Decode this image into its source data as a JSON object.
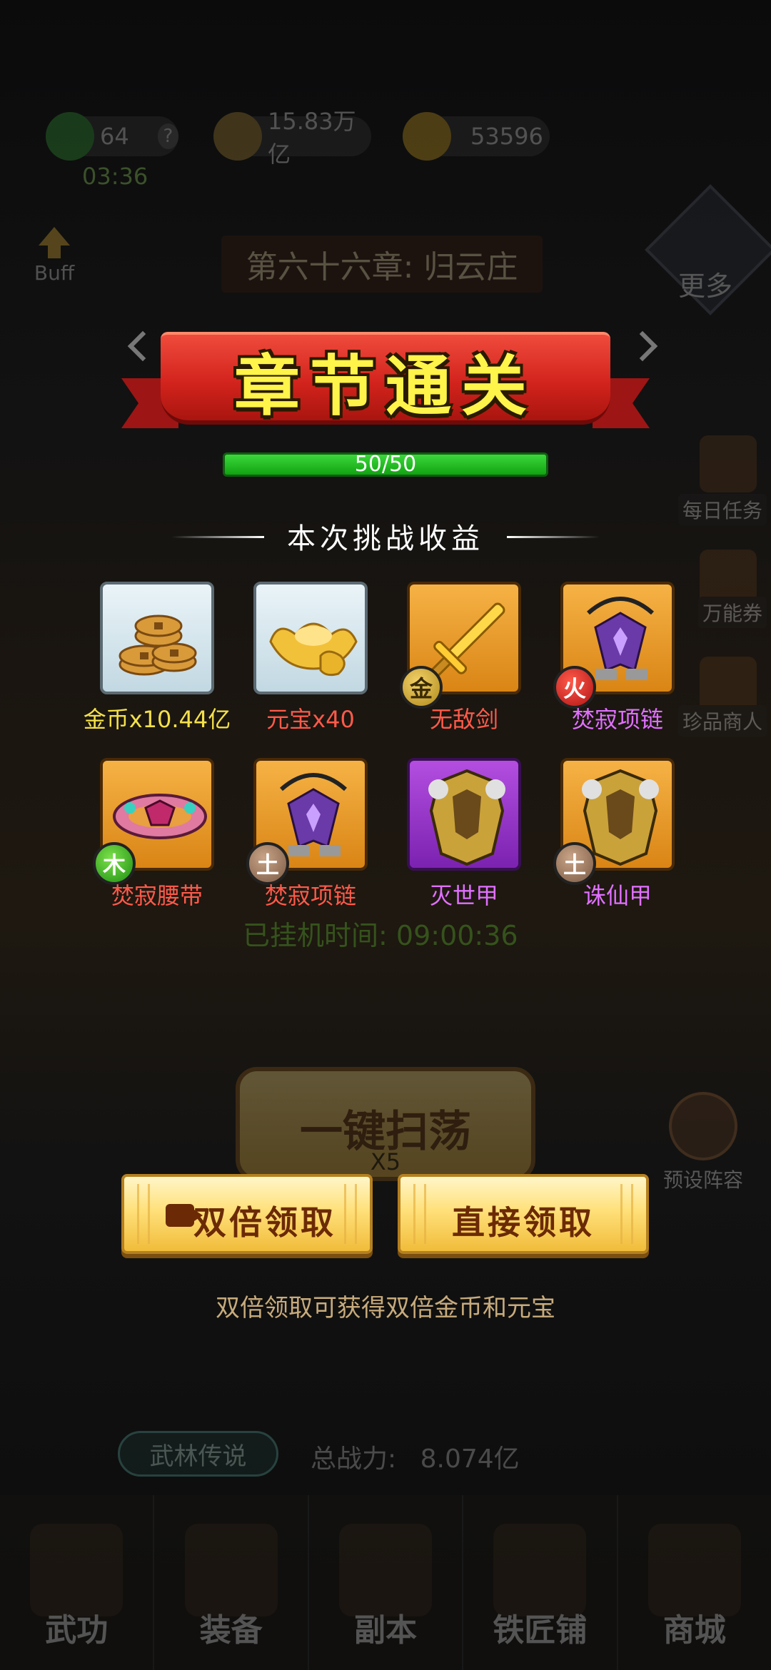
{
  "background": {
    "energy": "64",
    "energy_help": "?",
    "energy_timer": "03:36",
    "coins": "15.83万亿",
    "ingots": "53596",
    "buff_label": "Buff",
    "chapter_title": "第六十六章: 归云庄",
    "more_label": "更多",
    "side_items": [
      "每日任务",
      "万能券",
      "珍品商人"
    ],
    "idle_time_label": "已挂机时间:",
    "idle_time_value": "09:00:36",
    "sweep_label": "一键扫荡",
    "sweep_cost": "X5",
    "preset_label": "预设阵容",
    "legend_tag": "武林传说",
    "total_power_label": "总战力:",
    "total_power_value": "8.074亿",
    "bottom_tabs": [
      "武功",
      "装备",
      "副本",
      "铁匠铺",
      "商城"
    ]
  },
  "popup": {
    "banner_title": "章节通关",
    "progress_text": "50/50",
    "progress_fraction": 1.0,
    "section_title": "本次挑战收益",
    "rewards": [
      {
        "name": "金币x10.44亿",
        "icon": "gold-coins-icon",
        "frame": "white",
        "name_color": "#f4e04a"
      },
      {
        "name": "元宝x40",
        "icon": "gold-ingot-icon",
        "frame": "white",
        "name_color": "#ff5a4a"
      },
      {
        "name": "无敌剑",
        "icon": "sword-icon",
        "frame": "orange",
        "name_color": "#ff5a4a",
        "element": "金",
        "element_type": "gold"
      },
      {
        "name": "焚寂项链",
        "icon": "necklace-icon",
        "frame": "orange",
        "name_color": "#e070ff",
        "element": "火",
        "element_type": "fire"
      },
      {
        "name": "焚寂腰带",
        "icon": "belt-icon",
        "frame": "orange",
        "name_color": "#ff5a4a",
        "element": "木",
        "element_type": "wood"
      },
      {
        "name": "焚寂项链",
        "icon": "necklace-icon",
        "frame": "orange",
        "name_color": "#ff5a4a",
        "element": "土",
        "element_type": "earth"
      },
      {
        "name": "灭世甲",
        "icon": "armor-icon",
        "frame": "purple",
        "name_color": "#e070ff"
      },
      {
        "name": "诛仙甲",
        "icon": "armor-icon",
        "frame": "orange",
        "name_color": "#e070ff",
        "element": "土",
        "element_type": "earth"
      }
    ],
    "double_claim_label": "双倍领取",
    "direct_claim_label": "直接领取",
    "hint": "双倍领取可获得双倍金币和元宝"
  },
  "colors": {
    "banner_red": "#d3241d",
    "banner_text": "#fff44a",
    "progress_green": "#1fa51f",
    "button_gold": "#ffe07a",
    "hint_text": "#c8ab7c"
  }
}
